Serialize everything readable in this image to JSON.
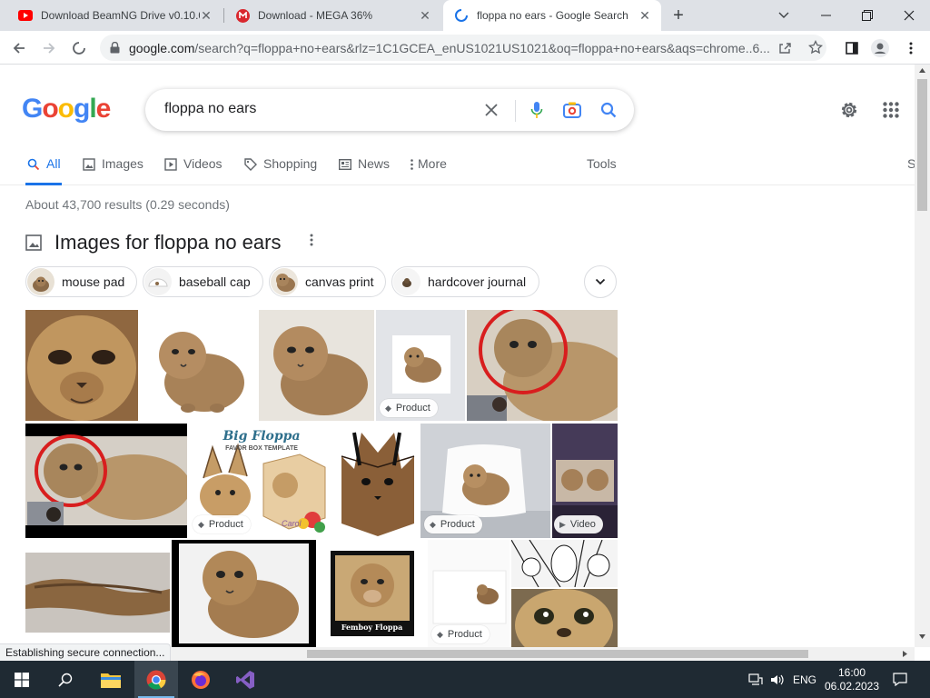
{
  "browser": {
    "tabs": [
      {
        "title": "Download BeamNG Drive v0.10.0",
        "favicon": "youtube-icon",
        "close": "✕"
      },
      {
        "title": "Download - MEGA 36%",
        "favicon": "mega-icon",
        "close": "✕"
      },
      {
        "title": "floppa no ears - Google Search",
        "favicon": "loading-spinner-icon",
        "close": "✕",
        "active": true
      }
    ],
    "new_tab": "+",
    "url_host": "google.com",
    "url_rest": "/search?q=floppa+no+ears&rlz=1C1GCEA_enUS1021US1021&oq=floppa+no+ears&aqs=chrome..6..."
  },
  "logo": {
    "letters": [
      "G",
      "o",
      "o",
      "g",
      "l",
      "e"
    ],
    "colors": [
      "#4285f4",
      "#ea4335",
      "#fbbc05",
      "#4285f4",
      "#34a853",
      "#ea4335"
    ]
  },
  "search": {
    "query": "floppa no ears"
  },
  "nav_tabs": [
    {
      "label": "All",
      "icon": "search-icon"
    },
    {
      "label": "Images",
      "icon": "image-icon"
    },
    {
      "label": "Videos",
      "icon": "video-icon"
    },
    {
      "label": "Shopping",
      "icon": "tag-icon"
    },
    {
      "label": "News",
      "icon": "news-icon"
    },
    {
      "label": "More",
      "icon": "more-vert-icon"
    }
  ],
  "tools_label": "Tools",
  "safesearch_partial": "S",
  "result_stats": "About 43,700 results (0.29 seconds)",
  "images_section": {
    "title": "Images for floppa no ears",
    "chips": [
      "mouse pad",
      "baseball cap",
      "canvas print",
      "hardcover journal"
    ],
    "badges": {
      "product": "Product",
      "video": "Video"
    },
    "tile_texts": {
      "big_floppa_1": "Big Floppa",
      "big_floppa_2": "FAVOR BOX TEMPLATE",
      "carol": "Carol",
      "femboy": "Femboy Floppa"
    }
  },
  "status_text": "Establishing secure connection...",
  "taskbar": {
    "lang": "ENG",
    "time": "16:00",
    "date": "06.02.2023"
  },
  "colors": {
    "accent": "#1a73e8",
    "taskbar": "#1f2a33",
    "floppa_fur": "#b08a5a"
  }
}
